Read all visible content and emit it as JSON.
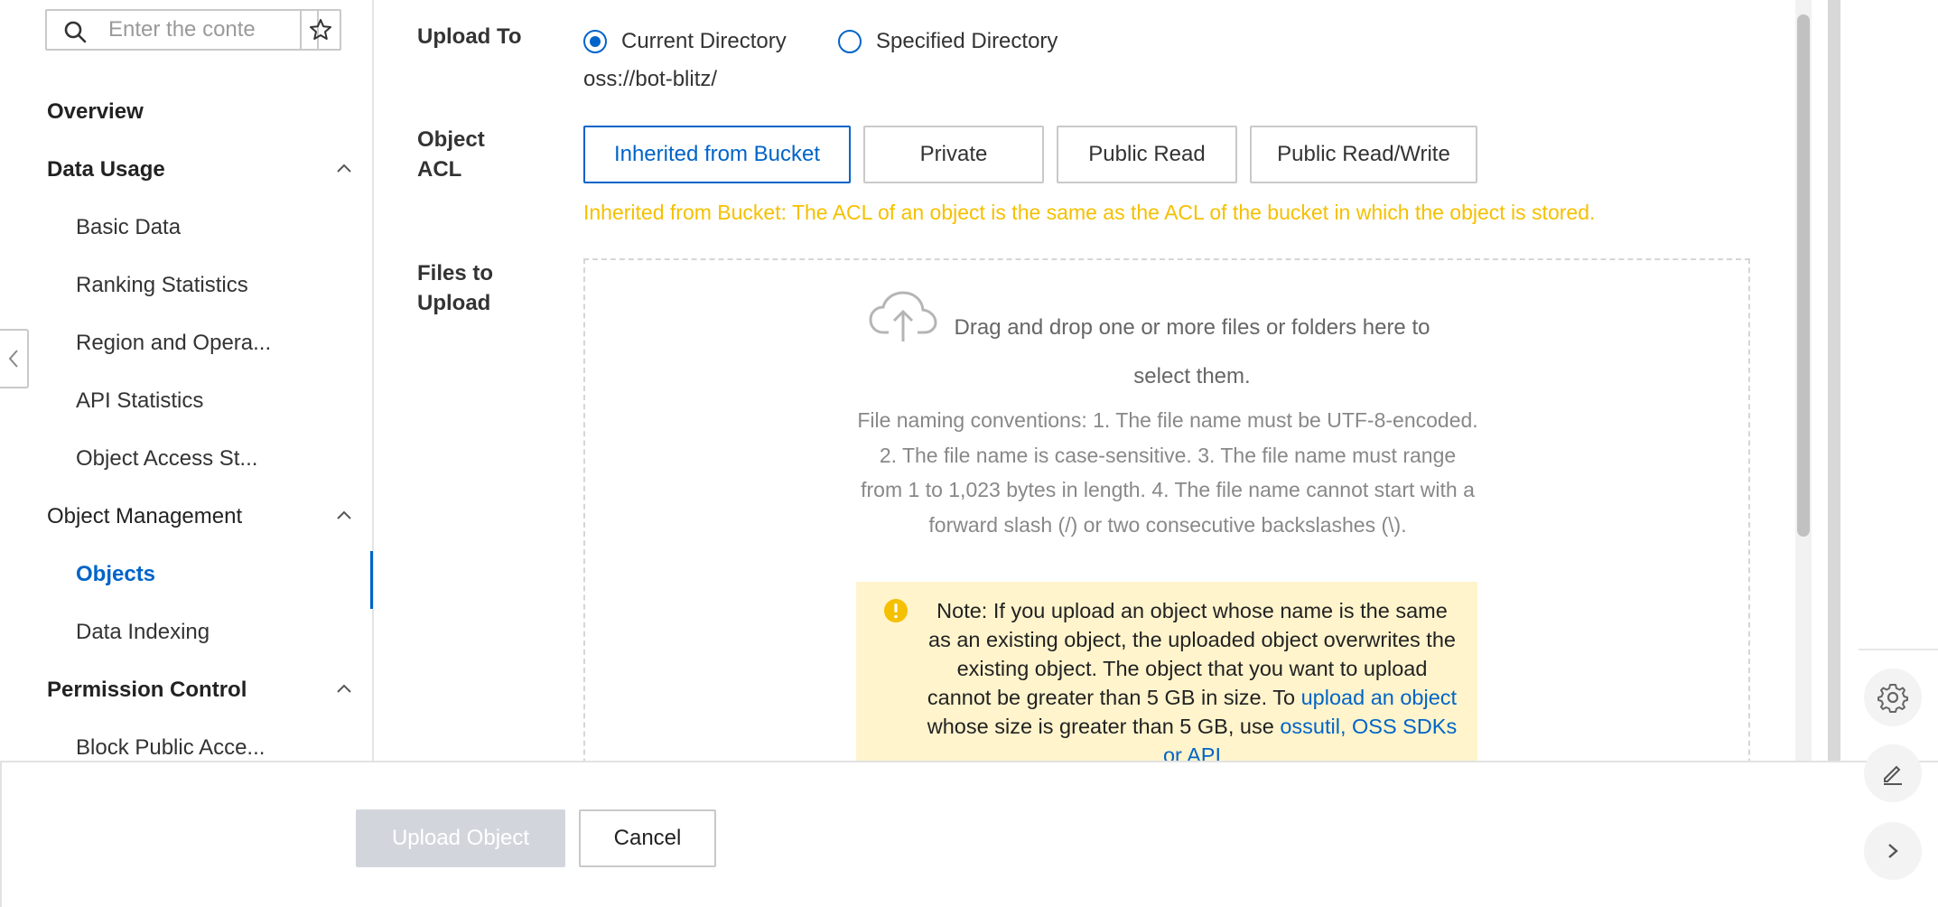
{
  "sidebar": {
    "search_placeholder": "Enter the conte",
    "items": [
      {
        "label": "Overview"
      },
      {
        "label": "Data Usage"
      },
      {
        "label": "Basic Data"
      },
      {
        "label": "Ranking Statistics"
      },
      {
        "label": "Region and Opera..."
      },
      {
        "label": "API Statistics"
      },
      {
        "label": "Object Access St..."
      },
      {
        "label": "Object Management"
      },
      {
        "label": "Objects"
      },
      {
        "label": "Data Indexing"
      },
      {
        "label": "Permission Control"
      },
      {
        "label": "Block Public Acce..."
      }
    ]
  },
  "form": {
    "upload_to_label": "Upload To",
    "radio_current": "Current Directory",
    "radio_specified": "Specified Directory",
    "path": "oss://bot-blitz/",
    "acl_label_1": "Object",
    "acl_label_2": "ACL",
    "acl_options": [
      "Inherited from Bucket",
      "Private",
      "Public Read",
      "Public Read/Write"
    ],
    "acl_note": "Inherited from Bucket: The ACL of an object is the same as the ACL of the bucket in which the object is stored.",
    "files_label_1": "Files to",
    "files_label_2": "Upload",
    "drag_text": "Drag and drop one or more files or folders here to select them.",
    "naming_text": "File naming conventions: 1. The file name must be UTF-8-encoded. 2. The file name is case-sensitive. 3. The file name must range from 1 to 1,023 bytes in length. 4. The file name cannot start with a forward slash (/) or two consecutive backslashes (\\).",
    "warn_text_1": "Note: If you upload an object whose name is the same as an existing object, the uploaded object overwrites the existing object. The object that you want to upload cannot be greater than 5 GB in size. To ",
    "warn_link_1": "upload an object",
    "warn_text_2": " whose size is greater than 5 GB, use ",
    "warn_link_2": "ossutil, OSS SDKs or API"
  },
  "footer": {
    "upload_button": "Upload Object",
    "cancel_button": "Cancel"
  },
  "colors": {
    "accent": "#0064c8",
    "warning_text": "#f5c000",
    "warning_bg": "#fff4cc",
    "disabled_button": "#d2d6dc"
  }
}
